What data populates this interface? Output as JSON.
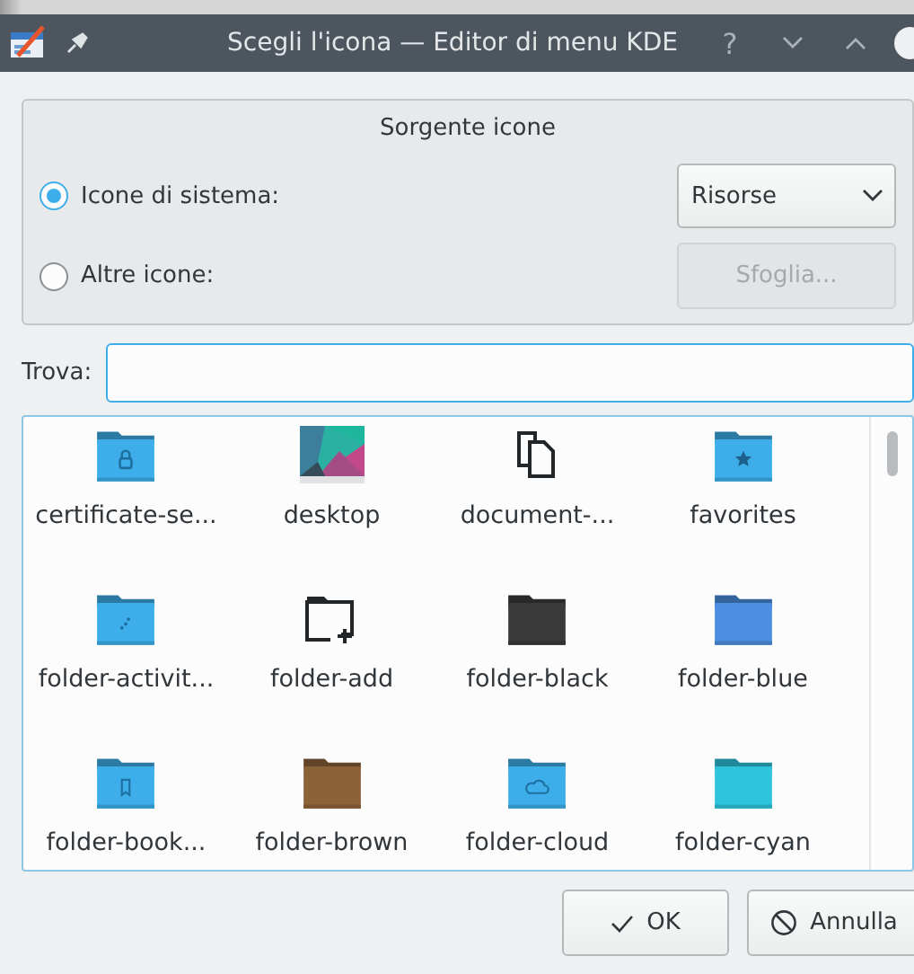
{
  "window": {
    "title": "Scegli l'icona — Editor di menu KDE",
    "controls": [
      "?"
    ]
  },
  "source": {
    "title": "Sorgente icone",
    "options": [
      {
        "label": "Icone di sistema:",
        "selected": true
      },
      {
        "label": "Altre icone:",
        "selected": false
      }
    ],
    "combo": {
      "value": "Risorse"
    },
    "browse": {
      "label": "Sfoglia...",
      "disabled": true
    }
  },
  "search": {
    "label": "Trova:"
  },
  "icons": [
    {
      "label": "certificate-se...",
      "kind": "lock-folder",
      "color": "#3daee9"
    },
    {
      "label": "desktop",
      "kind": "desktop"
    },
    {
      "label": "document-...",
      "kind": "document"
    },
    {
      "label": "favorites",
      "kind": "star-folder",
      "color": "#3daee9"
    },
    {
      "label": "folder-activit...",
      "kind": "dots-folder",
      "color": "#3daee9"
    },
    {
      "label": "folder-add",
      "kind": "folder-add"
    },
    {
      "label": "folder-black",
      "kind": "folder",
      "color": "#3a3a3a"
    },
    {
      "label": "folder-blue",
      "kind": "folder",
      "color": "#4c8fe0"
    },
    {
      "label": "folder-book...",
      "kind": "bookmark-folder",
      "color": "#3daee9"
    },
    {
      "label": "folder-brown",
      "kind": "folder",
      "color": "#8c6239"
    },
    {
      "label": "folder-cloud",
      "kind": "cloud-folder",
      "color": "#3daee9"
    },
    {
      "label": "folder-cyan",
      "kind": "folder",
      "color": "#2ec4dc"
    }
  ],
  "buttons": [
    {
      "label": "OK",
      "kind": "ok"
    },
    {
      "label": "Annulla",
      "kind": "cancel"
    }
  ]
}
